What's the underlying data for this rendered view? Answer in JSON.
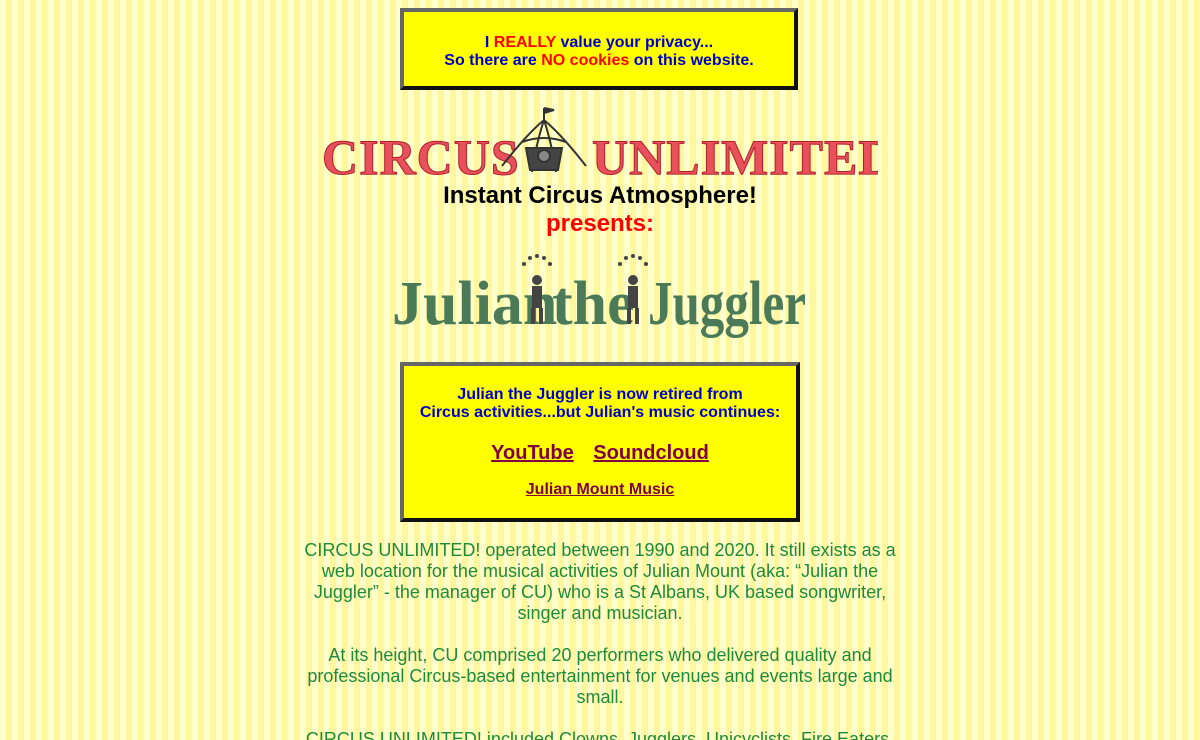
{
  "privacy": {
    "line1_pre": "I ",
    "line1_em": "REALLY",
    "line1_post": " value your privacy...",
    "line2_pre": "So there are ",
    "line2_em": "NO cookies",
    "line2_post": " on this website."
  },
  "logo": {
    "left_text": "CIRCUS",
    "right_text": "UNLIMITED!",
    "color": "#e8505a",
    "icon": "circus-tent-icon"
  },
  "tagline": "Instant Circus Atmosphere!",
  "presents": "presents:",
  "juggler_logo": {
    "word1": "Julian",
    "word2": "the",
    "word3": "Juggler",
    "color": "#4a7a58",
    "icon": "juggler-figure-icon"
  },
  "info": {
    "line1": "Julian the Juggler is now retired from",
    "line2": "Circus activities...but Julian's music continues:",
    "youtube": "YouTube",
    "soundcloud": "Soundcloud",
    "music": "Julian Mount Music"
  },
  "paragraphs": [
    "CIRCUS UNLIMITED! operated between 1990 and 2020. It still exists as a web location for the musical activities of Julian Mount (aka: “Julian the Juggler” - the manager of CU) who is a St Albans, UK based songwriter, singer and musician.",
    "At its height, CU comprised 20 performers who delivered quality and professional Circus-based entertainment for venues and events large and small.",
    "CIRCUS UNLIMITED! included Clowns, Jugglers, Unicyclists, Fire Eaters,"
  ]
}
